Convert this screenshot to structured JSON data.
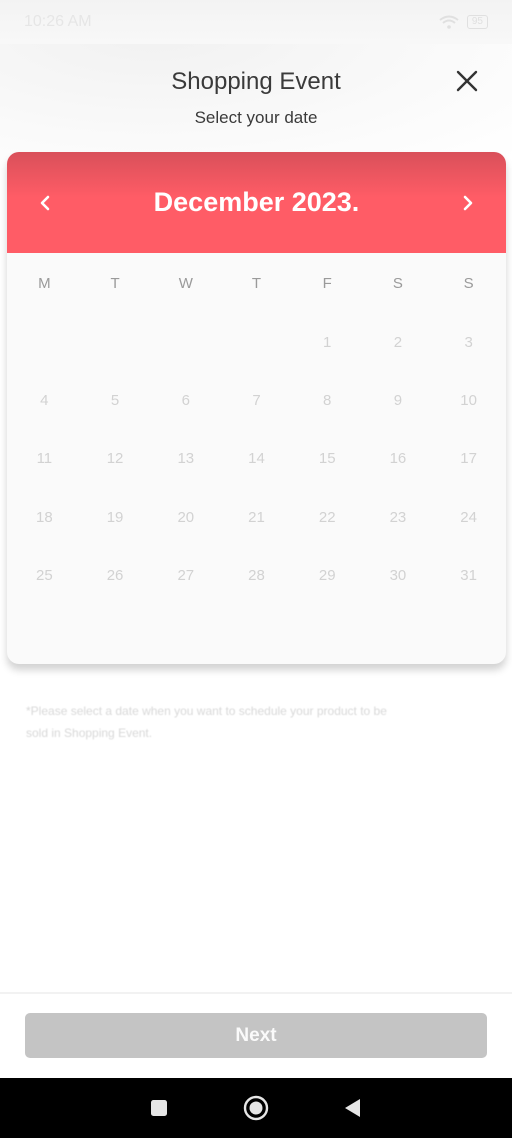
{
  "status_bar": {
    "time": "10:26 AM",
    "battery": "95"
  },
  "header": {
    "title": "Shopping Event",
    "subtitle": "Select your date"
  },
  "calendar": {
    "month_label": "December 2023.",
    "weekdays": [
      "M",
      "T",
      "W",
      "T",
      "F",
      "S",
      "S"
    ],
    "weeks": [
      [
        "",
        "",
        "",
        "",
        "1",
        "2",
        "3"
      ],
      [
        "4",
        "5",
        "6",
        "7",
        "8",
        "9",
        "10"
      ],
      [
        "11",
        "12",
        "13",
        "14",
        "15",
        "16",
        "17"
      ],
      [
        "18",
        "19",
        "20",
        "21",
        "22",
        "23",
        "24"
      ],
      [
        "25",
        "26",
        "27",
        "28",
        "29",
        "30",
        "31"
      ]
    ]
  },
  "note": "*Please select a date when you want to schedule your product to be sold in Shopping Event.",
  "footer": {
    "next_label": "Next"
  },
  "colors": {
    "accent": "#ff5c66",
    "disabled_button": "#c4c4c4"
  },
  "icons": {
    "close": "close-icon",
    "prev": "chevron-left-icon",
    "next": "chevron-right-icon",
    "nav_recents": "square-icon",
    "nav_home": "circle-icon",
    "nav_back": "triangle-back-icon"
  }
}
